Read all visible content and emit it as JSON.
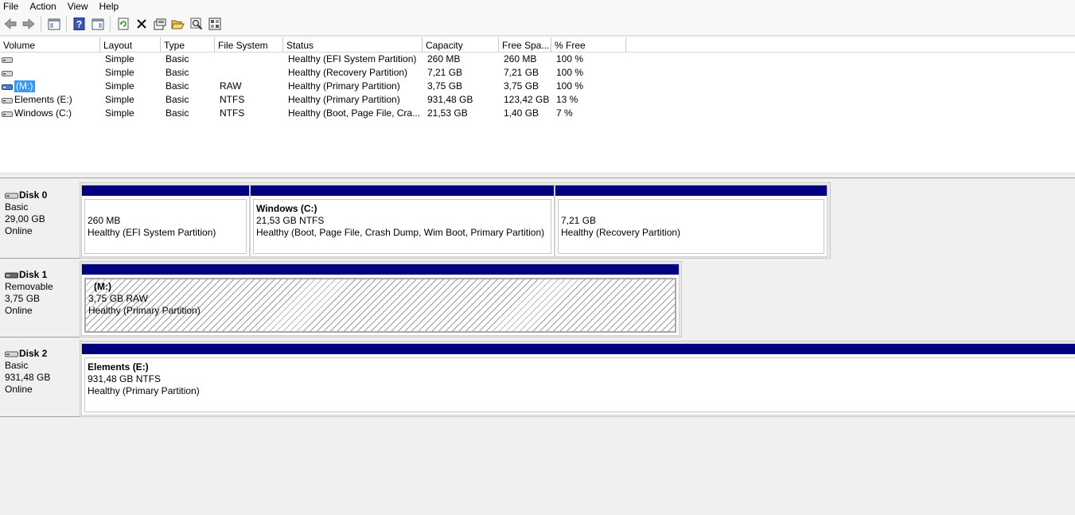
{
  "menu": [
    "File",
    "Action",
    "View",
    "Help"
  ],
  "toolbar": {
    "buttons": [
      "back-arrow-icon",
      "forward-arrow-icon",
      "show-hide-console-tree-icon",
      "help-icon",
      "show-action-pane-icon",
      "refresh-icon",
      "delete-icon",
      "properties-icon",
      "open-folder-icon",
      "explore-magnifier-icon",
      "disk-properties-icon"
    ]
  },
  "volume_list": {
    "columns": [
      "Volume",
      "Layout",
      "Type",
      "File System",
      "Status",
      "Capacity",
      "Free Spa...",
      "% Free"
    ],
    "rows": [
      {
        "volume": "",
        "layout": "Simple",
        "type": "Basic",
        "fs": "",
        "status": "Healthy (EFI System Partition)",
        "capacity": "260 MB",
        "free": "260 MB",
        "pct": "100 %"
      },
      {
        "volume": "",
        "layout": "Simple",
        "type": "Basic",
        "fs": "",
        "status": "Healthy (Recovery Partition)",
        "capacity": "7,21 GB",
        "free": "7,21 GB",
        "pct": "100 %"
      },
      {
        "volume": "(M:)",
        "layout": "Simple",
        "type": "Basic",
        "fs": "RAW",
        "status": "Healthy (Primary Partition)",
        "capacity": "3,75 GB",
        "free": "3,75 GB",
        "pct": "100 %"
      },
      {
        "volume": "Elements (E:)",
        "layout": "Simple",
        "type": "Basic",
        "fs": "NTFS",
        "status": "Healthy (Primary Partition)",
        "capacity": "931,48 GB",
        "free": "123,42 GB",
        "pct": "13 %"
      },
      {
        "volume": "Windows (C:)",
        "layout": "Simple",
        "type": "Basic",
        "fs": "NTFS",
        "status": "Healthy (Boot, Page File, Cra...",
        "capacity": "21,53 GB",
        "free": "1,40 GB",
        "pct": "7 %"
      }
    ]
  },
  "disks": [
    {
      "name": "Disk 0",
      "kind": "Basic",
      "size": "29,00 GB",
      "state": "Online",
      "partitions": [
        {
          "title": "",
          "line1": "260 MB",
          "line2": "Healthy (EFI System Partition)"
        },
        {
          "title": "Windows  (C:)",
          "line1": "21,53 GB NTFS",
          "line2": "Healthy (Boot, Page File, Crash Dump, Wim Boot, Primary Partition)"
        },
        {
          "title": "",
          "line1": "7,21 GB",
          "line2": "Healthy (Recovery Partition)"
        }
      ]
    },
    {
      "name": "Disk 1",
      "kind": "Removable",
      "size": "3,75 GB",
      "state": "Online",
      "partitions": [
        {
          "title": "(M:)",
          "line1": "3,75 GB RAW",
          "line2": "Healthy (Primary Partition)"
        }
      ]
    },
    {
      "name": "Disk 2",
      "kind": "Basic",
      "size": "931,48 GB",
      "state": "Online",
      "partitions": [
        {
          "title": "Elements  (E:)",
          "line1": "931,48 GB NTFS",
          "line2": "Healthy (Primary Partition)"
        }
      ]
    }
  ],
  "colors": {
    "partition_bar": "#000080",
    "selection": "#3399ff"
  }
}
